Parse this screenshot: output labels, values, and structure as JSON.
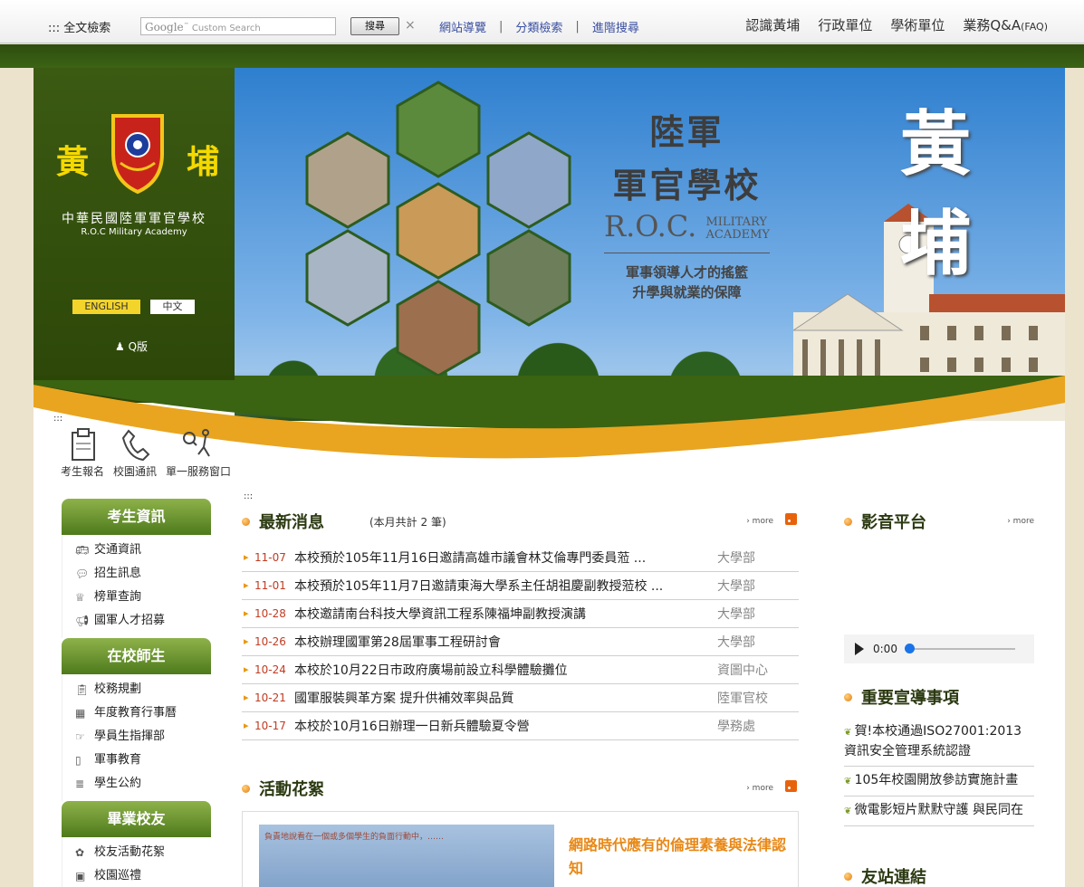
{
  "topbar": {
    "fulltext_search": "::: 全文檢索",
    "google_brand": "Google",
    "search_placeholder": "Custom Search",
    "search_button": "搜尋",
    "clear_symbol": "×",
    "links": [
      "網站導覽",
      "分類檢索",
      "進階搜尋"
    ],
    "right_nav": [
      "認識黃埔",
      "行政單位",
      "學術單位",
      "業務Q&A"
    ],
    "faq_suffix": "(FAQ)"
  },
  "logo": {
    "chars_left": "黃",
    "chars_right": "埔",
    "name_zh": "中華民國陸軍軍官學校",
    "name_en": "R.O.C Military Academy"
  },
  "lang": {
    "english": "ENGLISH",
    "chinese": "中文"
  },
  "q_version": "Q版",
  "banner": {
    "title_line1": "陸軍",
    "title_line2": "軍官學校",
    "roc": "R.O.C.",
    "roc_sub1": "MILITARY",
    "roc_sub2": "ACADEMY",
    "slogan1": "軍事領導人才的搖籃",
    "slogan2": "升學與就業的保障",
    "huangpu1": "黃",
    "huangpu2": "埔"
  },
  "quicklinks": [
    {
      "label": "考生報名",
      "icon": "clipboard-icon"
    },
    {
      "label": "校園通訊",
      "icon": "phone-icon"
    },
    {
      "label": "單一服務窗口",
      "icon": "service-icon"
    }
  ],
  "colons": ":::",
  "sidebar": [
    {
      "title": "考生資訊",
      "items": [
        {
          "label": "交通資訊",
          "icon": "bus-icon"
        },
        {
          "label": "招生訊息",
          "icon": "chat-icon"
        },
        {
          "label": "榜單查詢",
          "icon": "trophy-icon"
        },
        {
          "label": "國軍人才招募",
          "icon": "megaphone-icon"
        }
      ]
    },
    {
      "title": "在校師生",
      "items": [
        {
          "label": "校務規劃",
          "icon": "clipboard-icon"
        },
        {
          "label": "年度教育行事曆",
          "icon": "calendar-icon"
        },
        {
          "label": "學員生指揮部",
          "icon": "hand-icon"
        },
        {
          "label": "軍事教育",
          "icon": "book-icon"
        },
        {
          "label": "學生公約",
          "icon": "document-icon"
        }
      ]
    },
    {
      "title": "畢業校友",
      "items": [
        {
          "label": "校友活動花絮",
          "icon": "flower-icon"
        },
        {
          "label": "校園巡禮",
          "icon": "image-icon"
        }
      ]
    }
  ],
  "news": {
    "title": "最新消息",
    "count_text": "(本月共計 2 筆)",
    "more": "more",
    "rows": [
      {
        "date": "11-07",
        "title": "本校預於105年11月16日邀請高雄市議會林艾倫專門委員蒞 ...",
        "dept": "大學部"
      },
      {
        "date": "11-01",
        "title": "本校預於105年11月7日邀請東海大學系主任胡祖慶副教授蒞校 ...",
        "dept": "大學部"
      },
      {
        "date": "10-28",
        "title": "本校邀請南台科技大學資訊工程系陳福坤副教授演講",
        "dept": "大學部"
      },
      {
        "date": "10-26",
        "title": "本校辦理國軍第28屆軍事工程研討會",
        "dept": "大學部"
      },
      {
        "date": "10-24",
        "title": "本校於10月22日市政府廣場前設立科學體驗攤位",
        "dept": "資圖中心"
      },
      {
        "date": "10-21",
        "title": "國軍服裝興革方案 提升供補效率與品質",
        "dept": "陸軍官校"
      },
      {
        "date": "10-17",
        "title": "本校於10月16日辦理一日新兵體驗夏令營",
        "dept": "學務處"
      }
    ]
  },
  "gallery": {
    "title": "活動花絮",
    "more": "more",
    "image_text": "負責地說看在一個或多個學生的負面行動中，……",
    "item_title": "網路時代應有的倫理素養與法律認知"
  },
  "media": {
    "title": "影音平台",
    "more": "more",
    "time": "0:00"
  },
  "promo": {
    "title": "重要宣導事項",
    "items": [
      "賀!本校通過ISO27001:2013資訊安全管理系統認證",
      "105年校園開放參訪實施計畫",
      "微電影短片默默守護 與民同在"
    ]
  },
  "friends": {
    "title": "友站連結"
  },
  "colors": {
    "primary_green": "#3b5a12",
    "accent_orange": "#e88816",
    "date_red": "#c23b22"
  }
}
